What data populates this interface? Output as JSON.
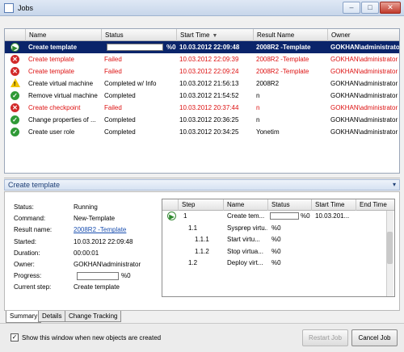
{
  "window": {
    "title": "Jobs",
    "controls": [
      "–",
      "□",
      "✕"
    ]
  },
  "jobs": {
    "columns": [
      "Name",
      "Status",
      "Start Time",
      "Result Name",
      "Owner"
    ],
    "sort_indicator": "▼",
    "rows": [
      {
        "icon": "running-icon",
        "name": "Create template",
        "status": "",
        "progress": "%0",
        "start": "10.03.2012 22:09:48",
        "result": "2008R2 -Template",
        "owner": "GOKHAN\\administrator",
        "state": "selected"
      },
      {
        "icon": "error-icon",
        "name": "Create template",
        "status": "Failed",
        "start": "10.03.2012 22:09:39",
        "result": "2008R2 -Template",
        "owner": "GOKHAN\\administrator",
        "state": "failed"
      },
      {
        "icon": "error-icon",
        "name": "Create template",
        "status": "Failed",
        "start": "10.03.2012 22:09:24",
        "result": "2008R2 -Template",
        "owner": "GOKHAN\\administrator",
        "state": "failed"
      },
      {
        "icon": "warning-icon",
        "name": "Create virtual machine",
        "status": "Completed w/ Info",
        "start": "10.03.2012 21:56:13",
        "result": "2008R2",
        "owner": "GOKHAN\\administrator",
        "state": "normal"
      },
      {
        "icon": "success-icon",
        "name": "Remove virtual machine",
        "status": "Completed",
        "start": "10.03.2012 21:54:52",
        "result": "n",
        "owner": "GOKHAN\\administrator",
        "state": "normal"
      },
      {
        "icon": "error-icon",
        "name": "Create checkpoint",
        "status": "Failed",
        "start": "10.03.2012 20:37:44",
        "result": "n",
        "owner": "GOKHAN\\administrator",
        "state": "failed"
      },
      {
        "icon": "success-icon",
        "name": "Change properties of ...",
        "status": "Completed",
        "start": "10.03.2012 20:36:25",
        "result": "n",
        "owner": "GOKHAN\\administrator",
        "state": "normal"
      },
      {
        "icon": "success-icon",
        "name": "Create user role",
        "status": "Completed",
        "start": "10.03.2012 20:34:25",
        "result": "Yonetim",
        "owner": "GOKHAN\\administrator",
        "state": "normal"
      }
    ]
  },
  "details": {
    "header": "Create template",
    "header_chevron": "▾",
    "props": [
      {
        "label": "Status:",
        "value": "Running"
      },
      {
        "label": "Command:",
        "value": "New-Template"
      },
      {
        "label": "Result name:",
        "value": "2008R2 -Template",
        "link": true
      },
      {
        "label": "Started:",
        "value": "10.03.2012 22:09:48"
      },
      {
        "label": "Duration:",
        "value": "00:00:01"
      },
      {
        "label": "Owner:",
        "value": "GOKHAN\\administrator"
      },
      {
        "label": "Progress:",
        "value": "%0"
      },
      {
        "label": "Current step:",
        "value": "Create template"
      }
    ],
    "progress_fraction": 0.0,
    "steps": {
      "columns": [
        "Step",
        "Name",
        "Status",
        "Start Time",
        "End Time"
      ],
      "rows": [
        {
          "step": "1",
          "name": "Create tem...",
          "status": "%0",
          "start": "10.03.201...",
          "running": true
        },
        {
          "step": "1.1",
          "name": "Sysprep virtu...",
          "status": "%0",
          "start": ""
        },
        {
          "step": "1.1.1",
          "name": "Start virtu...",
          "status": "%0",
          "start": ""
        },
        {
          "step": "1.1.2",
          "name": "Stop virtua...",
          "status": "%0",
          "start": ""
        },
        {
          "step": "1.2",
          "name": "Deploy virt...",
          "status": "%0",
          "start": ""
        }
      ]
    },
    "tabs": [
      "Summary",
      "Details",
      "Change Tracking"
    ]
  },
  "footer": {
    "checkbox_label": "Show this window when new objects are created",
    "checkbox_checked": "✓",
    "restart_label": "Restart Job",
    "cancel_label": "Cancel Job"
  }
}
